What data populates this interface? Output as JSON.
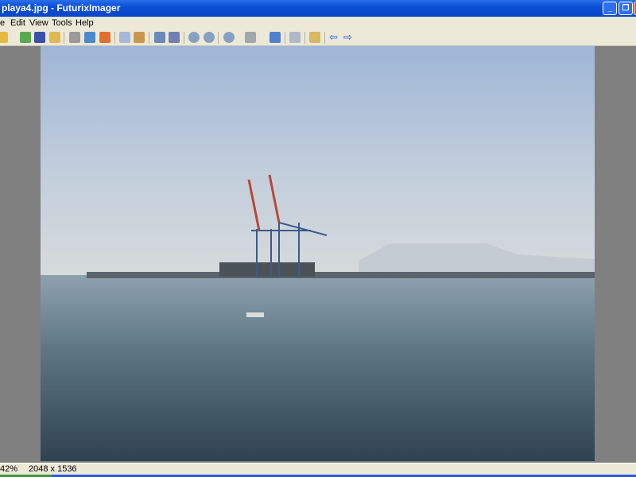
{
  "window": {
    "title": "playa4.jpg - FuturixImager"
  },
  "menu": [
    "e",
    "Edit",
    "View",
    "Tools",
    "Help"
  ],
  "toolbar": {
    "icons": [
      "open-icon",
      "refresh-icon",
      "save-icon",
      "open-folder-icon",
      "print-icon",
      "effects-icon",
      "plugin-icon",
      "copy-icon",
      "paste-icon",
      "image-properties-icon",
      "undo-icon",
      "zoom-in-icon",
      "zoom-out-icon",
      "zoom-menu-icon",
      "scan-icon",
      "fullscreen-icon",
      "info-icon",
      "browse-folder-icon",
      "previous-icon",
      "next-icon"
    ]
  },
  "status": {
    "zoom": "42%",
    "dimensions": "2048 x 1536"
  }
}
